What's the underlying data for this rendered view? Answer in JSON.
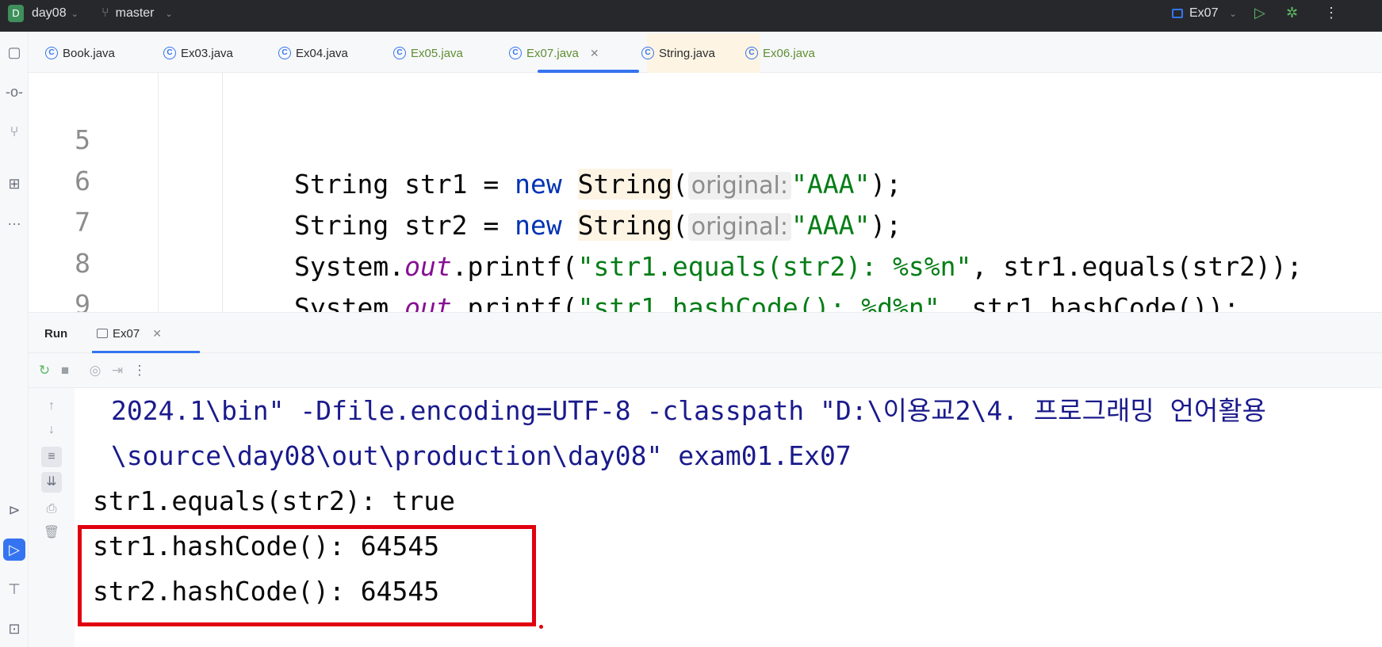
{
  "titlebar": {
    "project_badge": "D",
    "project": "day08",
    "branch": "master",
    "run_config": "Ex07"
  },
  "editor_tabs": [
    {
      "label": "Book.java"
    },
    {
      "label": "Ex03.java"
    },
    {
      "label": "Ex04.java"
    },
    {
      "label": "Ex05.java"
    },
    {
      "label": "Ex07.java"
    },
    {
      "label": "String.java"
    },
    {
      "label": "Ex06.java"
    }
  ],
  "code": {
    "lines": [
      {
        "num": "5"
      },
      {
        "num": "6"
      },
      {
        "num": "7"
      },
      {
        "num": "8"
      },
      {
        "num": "9"
      }
    ],
    "hint_label": "original:"
  },
  "run": {
    "title": "Run",
    "tab_label": "Ex07"
  },
  "console": {
    "lines": [
      "2024.1\\bin\" -Dfile.encoding=UTF-8 -classpath \"D:\\이용교2\\4. 프로그래밍 언어활용",
      "\\source\\day08\\out\\production\\day08\" exam01.Ex07",
      "str1.equals(str2): true",
      "str1.hashCode(): 64545",
      "str2.hashCode(): 64545"
    ]
  },
  "colors": {
    "highlight_box": "#e0000f",
    "accent": "#3574f0"
  }
}
